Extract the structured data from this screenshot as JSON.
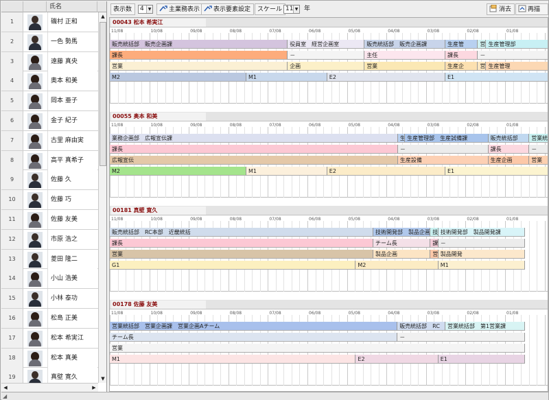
{
  "list": {
    "header_name": "氏名",
    "people": [
      {
        "num": "1",
        "name": "磯村 正和",
        "female": false
      },
      {
        "num": "2",
        "name": "一色 勢馬",
        "female": false
      },
      {
        "num": "3",
        "name": "遠藤 真央",
        "female": true
      },
      {
        "num": "4",
        "name": "奥本 和美",
        "female": true
      },
      {
        "num": "5",
        "name": "岡本 亜子",
        "female": true
      },
      {
        "num": "6",
        "name": "金子 紀子",
        "female": true
      },
      {
        "num": "7",
        "name": "古里 麻由実",
        "female": true
      },
      {
        "num": "8",
        "name": "高平 真希子",
        "female": true
      },
      {
        "num": "9",
        "name": "佐藤 久",
        "female": false
      },
      {
        "num": "10",
        "name": "佐藤 巧",
        "female": false
      },
      {
        "num": "11",
        "name": "佐藤 友美",
        "female": true
      },
      {
        "num": "12",
        "name": "市原 浩之",
        "female": false
      },
      {
        "num": "13",
        "name": "菱田 隆二",
        "female": false
      },
      {
        "num": "14",
        "name": "小山 浩美",
        "female": true
      },
      {
        "num": "15",
        "name": "小林 泰功",
        "female": false
      },
      {
        "num": "16",
        "name": "松島 正美",
        "female": true
      },
      {
        "num": "17",
        "name": "松本 希実江",
        "female": true
      },
      {
        "num": "18",
        "name": "松本 真美",
        "female": true
      },
      {
        "num": "19",
        "name": "真壁 寛久",
        "female": false
      }
    ]
  },
  "toolbar": {
    "display_count_label": "表示数",
    "display_count_value": "4",
    "main_duty_button": "主業務表示",
    "display_settings_button": "表示要素設定",
    "scale_label": "スケール",
    "scale_value": "11",
    "scale_unit": "年",
    "clear_button": "消去",
    "redraw_button": "再描画"
  },
  "ticks": [
    "11/08",
    "10/08",
    "09/08",
    "08/08",
    "07/08",
    "06/08",
    "05/08",
    "04/08",
    "03/08",
    "02/08",
    "01/08"
  ],
  "blocks": [
    {
      "title": "00043 松本 希実江",
      "rows": [
        [
          {
            "text": "販売統括部　販売企画課",
            "color": "#d4c4de",
            "s": 0,
            "e": 0.405
          },
          {
            "text": "役員室　経営企画室",
            "color": "#ece8f4",
            "s": 0.405,
            "e": 0.58
          },
          {
            "text": "販売統括部　販売企画課",
            "color": "#c8d4ea",
            "s": 0.58,
            "e": 0.764
          },
          {
            "text": "生産管",
            "color": "#b8d0f0",
            "s": 0.764,
            "e": 0.838
          },
          {
            "text": "営",
            "color": "#d0f0f0",
            "s": 0.838,
            "e": 0.857
          },
          {
            "text": "生産管理部",
            "color": "#c8f0f4",
            "s": 0.857,
            "e": 1.0
          }
        ],
        [
          {
            "text": "課長",
            "color": "#fdac7c",
            "s": 0,
            "e": 0.405
          },
          {
            "text": "－",
            "color": "#f4f4f4",
            "s": 0.405,
            "e": 0.58
          },
          {
            "text": "主任",
            "color": "#fce6ee",
            "s": 0.58,
            "e": 0.764
          },
          {
            "text": "課長",
            "color": "#fcd8e0",
            "s": 0.764,
            "e": 0.838
          },
          {
            "text": "－",
            "color": "#f2f2f2",
            "s": 0.838,
            "e": 1.0
          }
        ],
        [
          {
            "text": "営業",
            "color": "#fbf0d4",
            "s": 0,
            "e": 0.405
          },
          {
            "text": "企画",
            "color": "#fcf0c8",
            "s": 0.405,
            "e": 0.58
          },
          {
            "text": "営業",
            "color": "#fbe8b4",
            "s": 0.58,
            "e": 0.764
          },
          {
            "text": "生産企",
            "color": "#fce0b0",
            "s": 0.764,
            "e": 0.838
          },
          {
            "text": "営",
            "color": "#fce6c0",
            "s": 0.838,
            "e": 0.857
          },
          {
            "text": "生産管理",
            "color": "#fcd8b4",
            "s": 0.857,
            "e": 1.0
          }
        ],
        [
          {
            "text": "M2",
            "color": "#bac8e0",
            "s": 0,
            "e": 0.311
          },
          {
            "text": "M1",
            "color": "#c8d8ec",
            "s": 0.311,
            "e": 0.495
          },
          {
            "text": "E2",
            "color": "#e0e4ee",
            "s": 0.495,
            "e": 0.764
          },
          {
            "text": "E1",
            "color": "#d0e4f4",
            "s": 0.764,
            "e": 1.0
          }
        ]
      ]
    },
    {
      "title": "00055 奥本 和美",
      "rows": [
        [
          {
            "text": "業務企画部　広報宣伝課",
            "color": "#dce0f0",
            "s": 0,
            "e": 0.656
          },
          {
            "text": "生",
            "color": "#b8d0f0",
            "s": 0.656,
            "e": 0.672
          },
          {
            "text": "生産管理部　生産試備課",
            "color": "#a8c4ec",
            "s": 0.672,
            "e": 0.862
          },
          {
            "text": "販売統括部",
            "color": "#c0d8f0",
            "s": 0.862,
            "e": 0.955
          },
          {
            "text": "営業統",
            "color": "#c8f0f0",
            "s": 0.955,
            "e": 1.0
          }
        ],
        [
          {
            "text": "課長",
            "color": "#fcc8d4",
            "s": 0,
            "e": 0.656
          },
          {
            "text": "－",
            "color": "#ececec",
            "s": 0.656,
            "e": 0.862
          },
          {
            "text": "課長",
            "color": "#fcd8e0",
            "s": 0.862,
            "e": 0.955
          },
          {
            "text": "－",
            "color": "#ececec",
            "s": 0.955,
            "e": 1.0
          }
        ],
        [
          {
            "text": "広報宣伝",
            "color": "#e4c8a8",
            "s": 0,
            "e": 0.656
          },
          {
            "text": "生産設備",
            "color": "#fcd0b4",
            "s": 0.656,
            "e": 0.862
          },
          {
            "text": "生産企画",
            "color": "#fcc8a8",
            "s": 0.862,
            "e": 0.955
          },
          {
            "text": "営業",
            "color": "#fcd0b0",
            "s": 0.955,
            "e": 1.0
          }
        ],
        [
          {
            "text": "M2",
            "color": "#a4e48c",
            "s": 0,
            "e": 0.311
          },
          {
            "text": "M1",
            "color": "#fcf0dc",
            "s": 0.311,
            "e": 0.495
          },
          {
            "text": "E2",
            "color": "#fcecc8",
            "s": 0.495,
            "e": 0.764
          },
          {
            "text": "E1",
            "color": "#fcf4d0",
            "s": 0.764,
            "e": 1.0
          }
        ]
      ]
    },
    {
      "title": "00181 真壁 寛久",
      "rows": [
        [
          {
            "text": "販売統括部　RC本部　近畿統括",
            "color": "#d0dcec",
            "s": 0,
            "e": 0.6
          },
          {
            "text": "技術開発部　製品企画",
            "color": "#b0c8ec",
            "s": 0.6,
            "e": 0.73
          },
          {
            "text": "技",
            "color": "#c8f0f0",
            "s": 0.73,
            "e": 0.748
          },
          {
            "text": "技術開発部　製品開発課",
            "color": "#d8f4f8",
            "s": 0.748,
            "e": 0.945
          }
        ],
        [
          {
            "text": "課長",
            "color": "#fcc8d4",
            "s": 0,
            "e": 0.6
          },
          {
            "text": "チーム長",
            "color": "#f4e0e8",
            "s": 0.6,
            "e": 0.73
          },
          {
            "text": "課",
            "color": "#f4ccd8",
            "s": 0.73,
            "e": 0.748
          },
          {
            "text": "－",
            "color": "#ececec",
            "s": 0.748,
            "e": 0.945
          }
        ],
        [
          {
            "text": "営業",
            "color": "#d8c4a8",
            "s": 0,
            "e": 0.6
          },
          {
            "text": "製品企画",
            "color": "#fce4c4",
            "s": 0.6,
            "e": 0.73
          },
          {
            "text": "営",
            "color": "#fcc8a8",
            "s": 0.73,
            "e": 0.748
          },
          {
            "text": "製品開発",
            "color": "#fce8cc",
            "s": 0.748,
            "e": 0.945
          }
        ],
        [
          {
            "text": "G1",
            "color": "#fcf0c0",
            "s": 0,
            "e": 0.56
          },
          {
            "text": "M2",
            "color": "#fcecc4",
            "s": 0.56,
            "e": 0.748
          },
          {
            "text": "M1",
            "color": "#fcf0d0",
            "s": 0.748,
            "e": 0.945
          }
        ]
      ]
    },
    {
      "title": "00178 佐藤 友美",
      "rows": [
        [
          {
            "text": "営業統括部　営業企画課　営業企画Aチーム",
            "color": "#a8c0ec",
            "s": 0,
            "e": 0.655
          },
          {
            "text": "販売統括部　RC",
            "color": "#d0dcf0",
            "s": 0.655,
            "e": 0.764
          },
          {
            "text": "営業統括部　第1営業課",
            "color": "#d8f4f4",
            "s": 0.764,
            "e": 0.945
          }
        ],
        [
          {
            "text": "チーム長",
            "color": "#dce4f0",
            "s": 0,
            "e": 0.655
          },
          {
            "text": "－",
            "color": "#f0f0f0",
            "s": 0.655,
            "e": 0.945
          }
        ],
        [
          {
            "text": "営業",
            "color": "#f4f4f4",
            "s": 0,
            "e": 0.945
          }
        ],
        [
          {
            "text": "M1",
            "color": "#fce4e4",
            "s": 0,
            "e": 0.56
          },
          {
            "text": "E2",
            "color": "#f0d8e4",
            "s": 0.56,
            "e": 0.748
          },
          {
            "text": "E1",
            "color": "#e8d4e4",
            "s": 0.748,
            "e": 0.945
          }
        ]
      ]
    }
  ]
}
